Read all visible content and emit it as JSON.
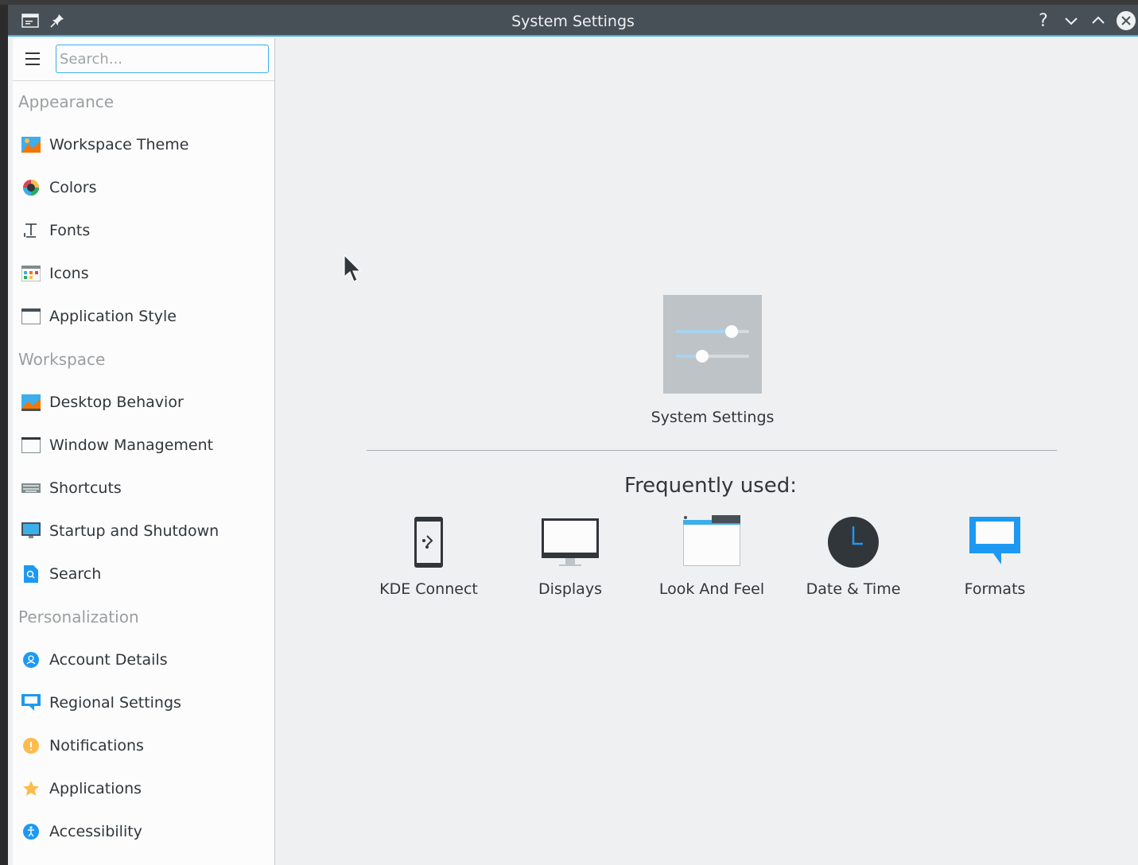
{
  "window": {
    "title": "System Settings"
  },
  "titlebar": {
    "help_glyph": "?"
  },
  "search": {
    "placeholder": "Search..."
  },
  "sidebar": {
    "categories": [
      {
        "label": "Appearance",
        "items": [
          {
            "label": "Workspace Theme",
            "icon": "workspace-theme-icon"
          },
          {
            "label": "Colors",
            "icon": "colors-icon"
          },
          {
            "label": "Fonts",
            "icon": "fonts-icon"
          },
          {
            "label": "Icons",
            "icon": "icons-icon"
          },
          {
            "label": "Application Style",
            "icon": "application-style-icon"
          }
        ]
      },
      {
        "label": "Workspace",
        "items": [
          {
            "label": "Desktop Behavior",
            "icon": "desktop-behavior-icon"
          },
          {
            "label": "Window Management",
            "icon": "window-management-icon"
          },
          {
            "label": "Shortcuts",
            "icon": "keyboard-icon"
          },
          {
            "label": "Startup and Shutdown",
            "icon": "startup-icon"
          },
          {
            "label": "Search",
            "icon": "search-doc-icon"
          }
        ]
      },
      {
        "label": "Personalization",
        "items": [
          {
            "label": "Account Details",
            "icon": "account-icon"
          },
          {
            "label": "Regional Settings",
            "icon": "regional-icon"
          },
          {
            "label": "Notifications",
            "icon": "notifications-icon"
          },
          {
            "label": "Applications",
            "icon": "star-icon"
          },
          {
            "label": "Accessibility",
            "icon": "accessibility-icon"
          }
        ]
      }
    ]
  },
  "main": {
    "app_label": "System Settings",
    "frequently_used_title": "Frequently used:",
    "frequently_used": [
      {
        "label": "KDE Connect",
        "icon": "kde-connect-icon"
      },
      {
        "label": "Displays",
        "icon": "display-icon"
      },
      {
        "label": "Look And Feel",
        "icon": "look-and-feel-icon"
      },
      {
        "label": "Date & Time",
        "icon": "clock-icon"
      },
      {
        "label": "Formats",
        "icon": "formats-icon"
      }
    ]
  },
  "colors": {
    "accent": "#3daee9",
    "titlebar": "#475057",
    "window_bg": "#eff0f1",
    "sidebar_bg": "#fcfcfc",
    "text": "#31363b",
    "category_text": "#9b9ea1"
  }
}
